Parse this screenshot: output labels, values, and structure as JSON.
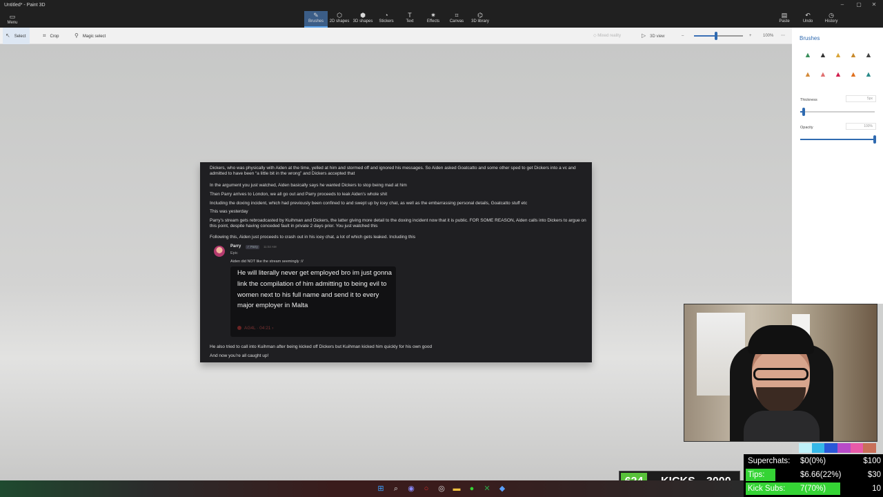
{
  "window": {
    "title": "Untitled* - Paint 3D",
    "menu_label": "Menu"
  },
  "ribbon": {
    "tools": [
      {
        "label": "Brushes",
        "icon": "brush-icon",
        "active": true
      },
      {
        "label": "2D shapes",
        "icon": "2d-shapes-icon"
      },
      {
        "label": "3D shapes",
        "icon": "3d-shapes-icon"
      },
      {
        "label": "Stickers",
        "icon": "stickers-icon"
      },
      {
        "label": "Text",
        "icon": "text-icon"
      },
      {
        "label": "Effects",
        "icon": "effects-icon"
      },
      {
        "label": "Canvas",
        "icon": "canvas-icon"
      },
      {
        "label": "3D library",
        "icon": "3d-library-icon"
      }
    ],
    "right": [
      {
        "label": "Paste",
        "icon": "paste-icon"
      },
      {
        "label": "Undo",
        "icon": "undo-icon"
      },
      {
        "label": "History",
        "icon": "history-icon"
      }
    ]
  },
  "toolbar2": {
    "select": "Select",
    "crop": "Crop",
    "magic_select": "Magic select",
    "mixed_reality": "Mixed reality",
    "view_3d": "3D view",
    "zoom": "100%",
    "zoom_level": 0.45
  },
  "panel": {
    "title": "Brushes",
    "thickness_label": "Thickness",
    "thickness_value": "5px",
    "thickness_level": 0.05,
    "opacity_label": "Opacity",
    "opacity_value": "100%",
    "opacity_level": 1.0,
    "brushes": [
      {
        "name": "marker-brush",
        "color": "#3a8f5c"
      },
      {
        "name": "calligraphy-pen-brush",
        "color": "#333333"
      },
      {
        "name": "oil-brush",
        "color": "#d9a53a"
      },
      {
        "name": "watercolor-brush",
        "color": "#c88a2c"
      },
      {
        "name": "pixel-pen-brush",
        "color": "#444444"
      },
      {
        "name": "pencil-brush",
        "color": "#d48a3a"
      },
      {
        "name": "eraser-brush",
        "color": "#e07070"
      },
      {
        "name": "crayon-brush",
        "color": "#d11e4e"
      },
      {
        "name": "spray-can-brush",
        "color": "#e0701e"
      },
      {
        "name": "fill-brush",
        "color": "#2a8a8a"
      }
    ]
  },
  "image": {
    "lines": [
      "Dickers, who was physically with Aiden at the time, yelled at him and stormed off and ignored his messages. So Aiden asked Goatcatto and some other sped to get Dickers into a vc and admitted to have been “a little bit in the wrong” and Dickers accepted that",
      "In the argument you just watched, Aiden basically says he wanted Dickers to stop being mad at him",
      "Then Parry arrives to London, we all go out and Parry proceeds to leak Aiden’s whole shit",
      "Including the doxing incident, which had previously been confined to and swept up by icey chat, as well as the embarrassing personal details, Goatcatto stuff etc",
      "This was yesterday",
      "Parry’s stream gets rebroadcasted by Kuihman and Dickers, the latter giving more detail to the doxing incident now that it is public. FOR SOME REASON, Aiden calls into Dickers to argue on this point, despite having conceded fault in private 2 days prior. You just watched this",
      "Following this, Aiden just proceeds to crash out in his icey chat, a lot of which gets leaked. Including this"
    ],
    "post": {
      "author": "Parry",
      "tag": "✓ Parry",
      "time": "11:02 AM",
      "subtitle": "Epic",
      "message": "Aiden did NOT like the stream seemingly ://",
      "quote": "He will literally never get employed bro im just gonna link the compilation of him admitting to being evil to women next to his full name and send it to every major employer in Malta",
      "quote_source": "AG4L · 04:21 ›"
    },
    "footer_lines": [
      "He also tried to call into Kuihman after being kicked off Dickers but Kuihman kicked him quickly for his own good",
      "And now you’re all caught up!"
    ]
  },
  "overlay": {
    "kicks_count": "624",
    "kicks_label": "KICKS",
    "kicks_goal": "3000",
    "rows": [
      {
        "label": "Superchats:",
        "value": "$0(0%)",
        "goal": "$100",
        "fill": 0.0
      },
      {
        "label": "Tips:",
        "value": "$6.66(22%)",
        "goal": "$30",
        "fill": 0.22
      },
      {
        "label": "Kick Subs:",
        "value": "7(70%)",
        "goal": "10",
        "fill": 0.7
      }
    ]
  },
  "colors": {
    "accent": "#2f6ab0",
    "overlay_green": "#35d435",
    "kicks_green": "#58c23a"
  },
  "swatches": [
    "#bff0f8",
    "#35b8e8",
    "#2a58d8",
    "#b84ac8",
    "#e85aa8",
    "#c8705a"
  ],
  "taskbar": [
    "windows-start-icon",
    "search-icon",
    "discord-icon",
    "opera-icon",
    "chrome-icon",
    "file-explorer-icon",
    "spotify-icon",
    "excel-icon",
    "paint3d-icon"
  ]
}
